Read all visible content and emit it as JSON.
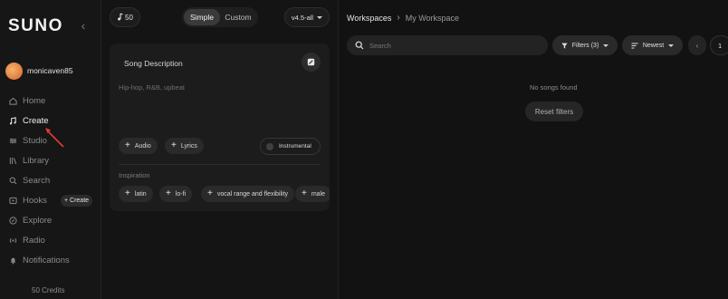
{
  "sidebar": {
    "logo": "SUNO",
    "username": "monicaven85",
    "items": [
      {
        "label": "Home",
        "icon": "home-icon"
      },
      {
        "label": "Create",
        "icon": "music-note-icon"
      },
      {
        "label": "Studio",
        "icon": "studio-icon"
      },
      {
        "label": "Library",
        "icon": "library-icon"
      },
      {
        "label": "Search",
        "icon": "search-icon"
      },
      {
        "label": "Hooks",
        "icon": "hooks-icon"
      },
      {
        "label": "Explore",
        "icon": "explore-icon"
      },
      {
        "label": "Radio",
        "icon": "radio-icon"
      },
      {
        "label": "Notifications",
        "icon": "bell-icon"
      }
    ],
    "active_item": "Create",
    "hooks_create_label": "+ Create",
    "credits": "50 Credits"
  },
  "create": {
    "credit_count": "50",
    "mode_simple": "Simple",
    "mode_custom": "Custom",
    "selected_mode": "Simple",
    "version": "v4.5-all",
    "card": {
      "title": "Song Description",
      "placeholder": "Hip-hop, R&B, upbeat",
      "audio_label": "Audio",
      "lyrics_label": "Lyrics",
      "instrumental_label": "Instrumental",
      "instrumental_on": false,
      "inspiration_label": "Inspiration",
      "inspiration_tags": [
        "latin",
        "lo-fi",
        "vocal range and flexibility",
        "male"
      ]
    }
  },
  "workspace": {
    "breadcrumb_root": "Workspaces",
    "breadcrumb_current": "My Workspace",
    "search_placeholder": "Search",
    "filters_label": "Filters (3)",
    "sort_label": "Newest",
    "page_prev": "‹",
    "page_number": "1",
    "empty_message": "No songs found",
    "reset_label": "Reset filters"
  },
  "colors": {
    "background": "#121212",
    "annotation_arrow": "#e53935"
  }
}
